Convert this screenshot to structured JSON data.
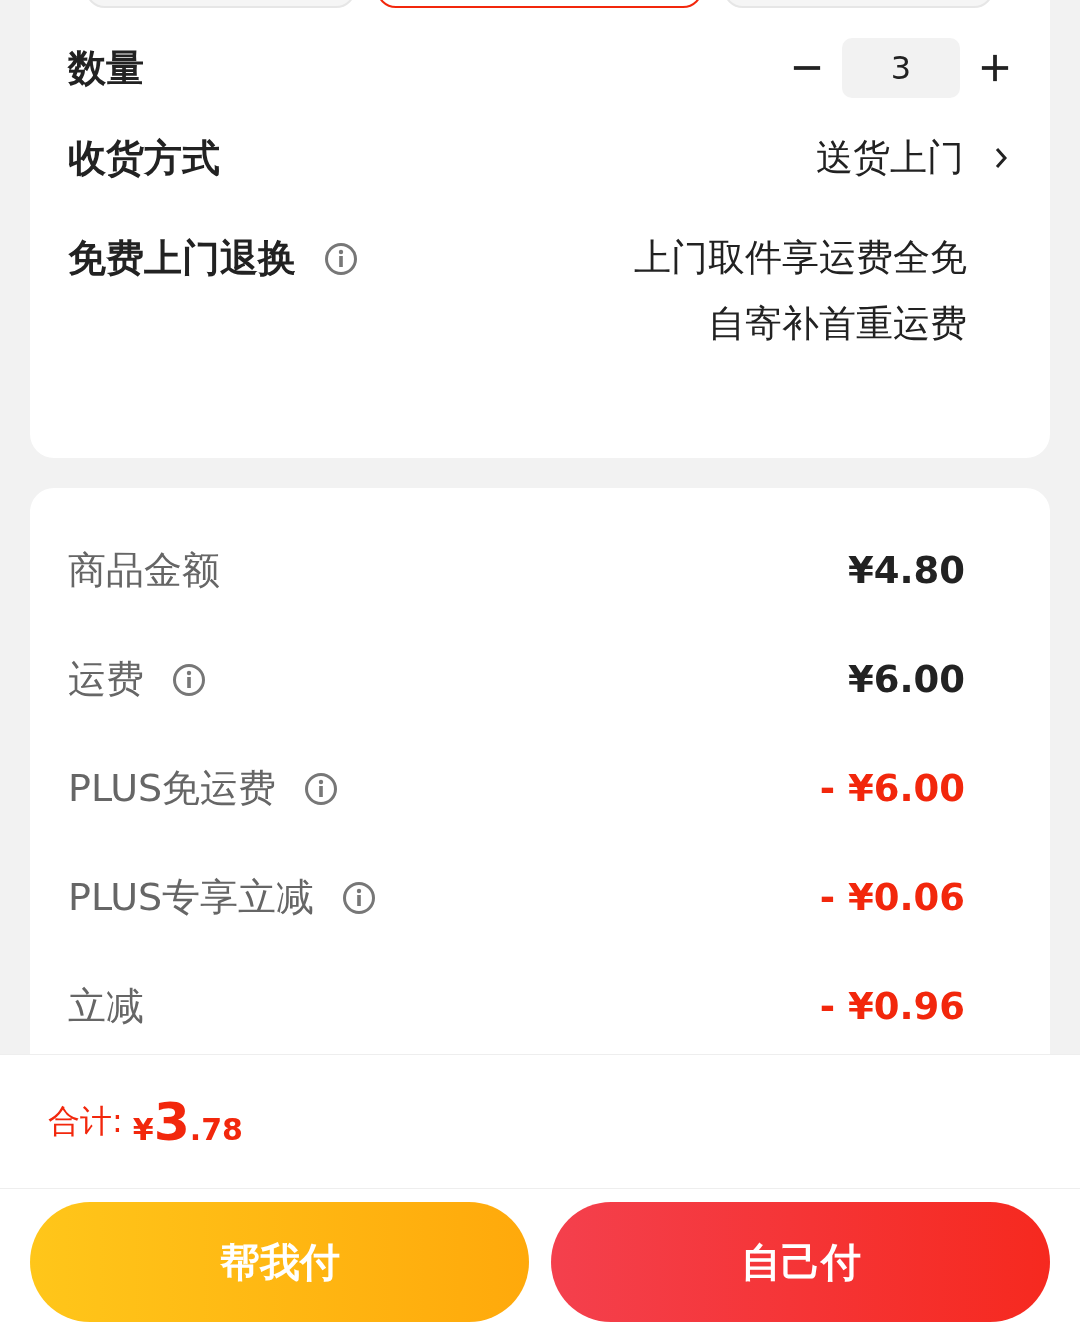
{
  "variant_chips": [
    {
      "selected": false
    },
    {
      "selected": true
    },
    {
      "selected": false
    }
  ],
  "quantity": {
    "label": "数量",
    "value": "3"
  },
  "delivery": {
    "label": "收货方式",
    "value": "送货上门"
  },
  "return_service": {
    "label": "免费上门退换",
    "info": true,
    "lines": [
      "上门取件享运费全免",
      "自寄补首重运费"
    ]
  },
  "fees": [
    {
      "label": "商品金额",
      "info": false,
      "amount": "¥4.80",
      "kind": "charge"
    },
    {
      "label": "运费",
      "info": true,
      "amount": "¥6.00",
      "kind": "charge"
    },
    {
      "label": "PLUS免运费",
      "info": true,
      "amount": "- ¥6.00",
      "kind": "discount"
    },
    {
      "label": "PLUS专享立减",
      "info": true,
      "amount": "- ¥0.06",
      "kind": "discount"
    },
    {
      "label": "立减",
      "info": false,
      "amount": "- ¥0.96",
      "kind": "discount"
    }
  ],
  "total": {
    "label": "合计:",
    "currency": "¥",
    "integer": "3",
    "decimal": ".78"
  },
  "buttons": [
    {
      "label": "帮我付",
      "kind": "friend"
    },
    {
      "label": "自己付",
      "kind": "self"
    }
  ]
}
